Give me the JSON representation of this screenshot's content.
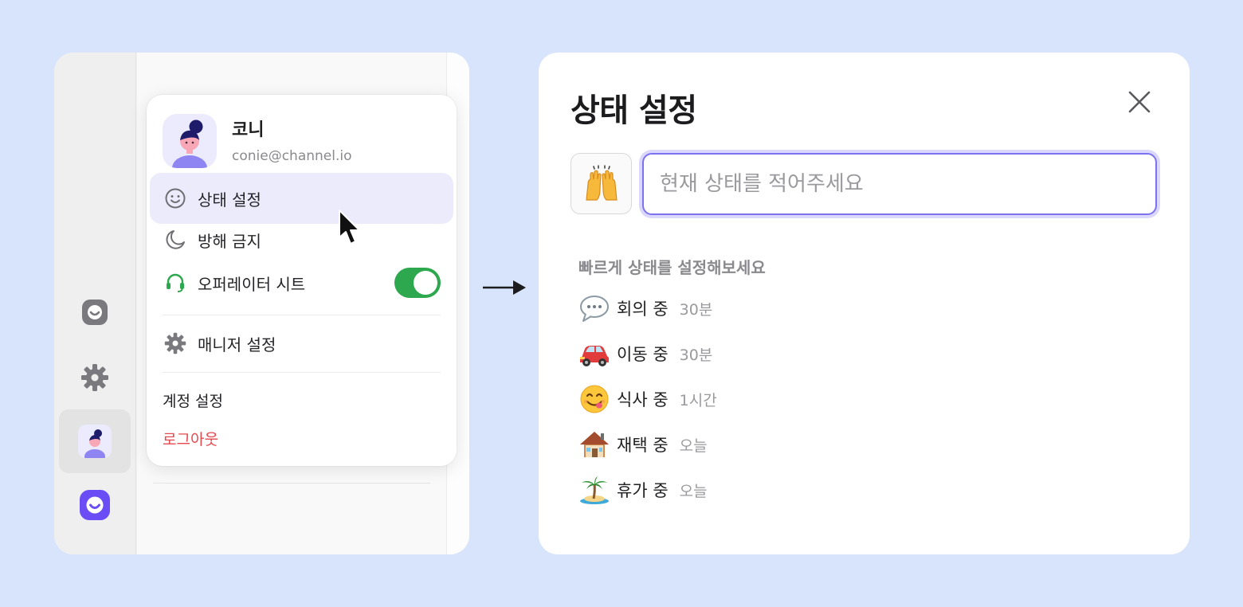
{
  "profile": {
    "name": "코니",
    "email": "conie@channel.io"
  },
  "menu": {
    "status_setting": "상태 설정",
    "do_not_disturb": "방해 금지",
    "operator_sheet": "오퍼레이터 시트",
    "operator_sheet_on": true,
    "manager_settings": "매니저 설정",
    "account_settings": "계정 설정",
    "logout": "로그아웃"
  },
  "rail": {
    "items": [
      "channel-icon",
      "gear-icon",
      "avatar",
      "channel-talk-logo"
    ],
    "active": "avatar"
  },
  "status_panel": {
    "title": "상태 설정",
    "emoji": "raising-hands",
    "input_placeholder": "현재 상태를 적어주세요",
    "input_value": "",
    "quick_heading": "빠르게 상태를 설정해보세요",
    "quick_options": [
      {
        "emoji": "speech-bubble",
        "label": "회의 중",
        "duration": "30분"
      },
      {
        "emoji": "car",
        "label": "이동 중",
        "duration": "30분"
      },
      {
        "emoji": "yum-face",
        "label": "식사 중",
        "duration": "1시간"
      },
      {
        "emoji": "house",
        "label": "재택 중",
        "duration": "오늘"
      },
      {
        "emoji": "desert-island",
        "label": "휴가 중",
        "duration": "오늘"
      }
    ]
  },
  "colors": {
    "background": "#d8e4fc",
    "accent": "#7c72f0",
    "toggle_on": "#2ea84f",
    "logout": "#e5484d",
    "brand": "#6b4df5"
  }
}
